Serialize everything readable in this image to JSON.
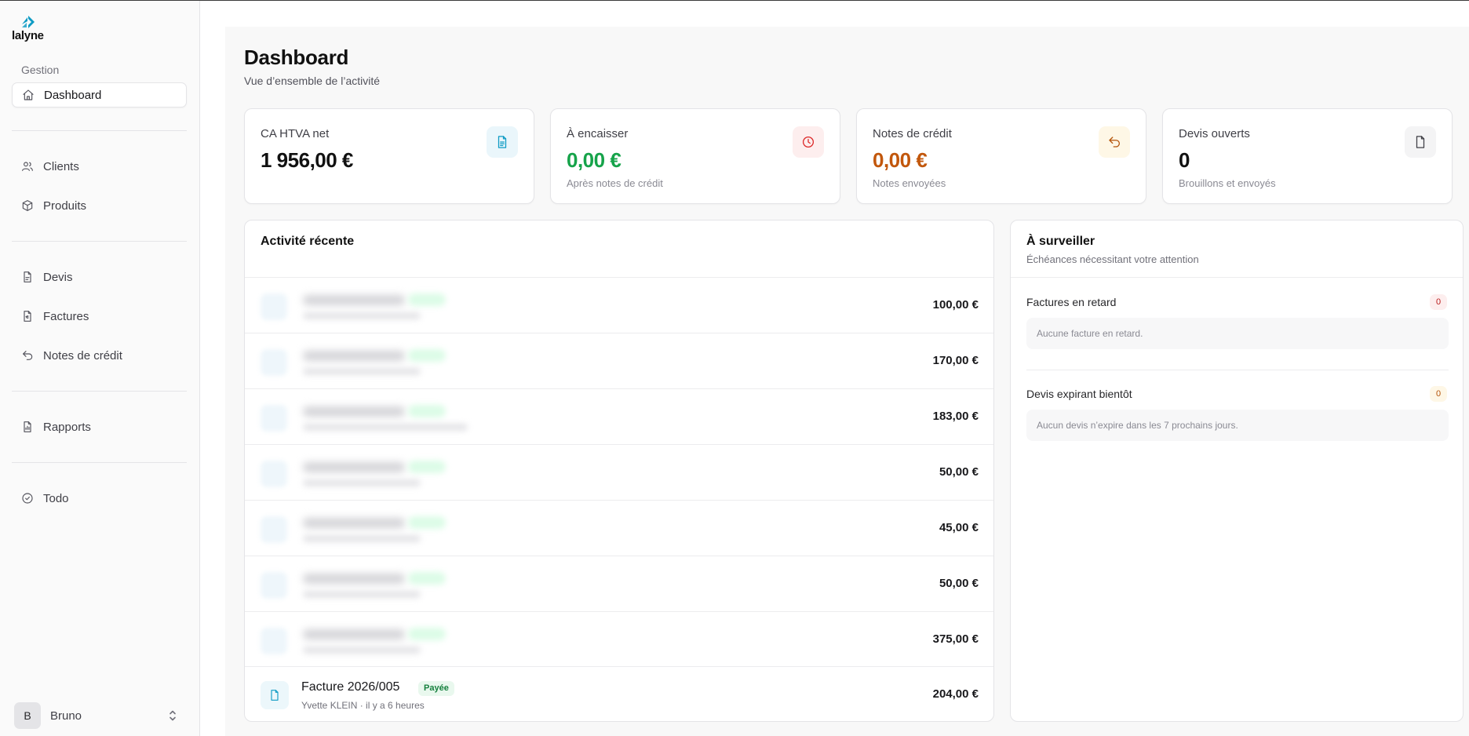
{
  "brand": {
    "name": "lalyne",
    "accent": "#0e9bc4"
  },
  "sidebar": {
    "section_label": "Gestion",
    "items": [
      {
        "label": "Dashboard",
        "icon": "home-icon",
        "active": true
      },
      {
        "label": "Clients",
        "icon": "users-icon"
      },
      {
        "label": "Produits",
        "icon": "box-icon"
      },
      {
        "label": "Devis",
        "icon": "file-icon"
      },
      {
        "label": "Factures",
        "icon": "invoice-icon"
      },
      {
        "label": "Notes de crédit",
        "icon": "undo-icon"
      },
      {
        "label": "Rapports",
        "icon": "report-icon"
      },
      {
        "label": "Todo",
        "icon": "check-circle-icon"
      }
    ],
    "user": {
      "initial": "B",
      "name": "Bruno"
    }
  },
  "header": {
    "title": "Dashboard",
    "subtitle": "Vue d’ensemble de l’activité"
  },
  "stats": [
    {
      "label": "CA HTVA net",
      "value": "1 956,00 €",
      "sub": "",
      "color": "#111111",
      "icon": "document-icon",
      "icon_bg": "#eaf6fb",
      "icon_color": "#0e9bc4"
    },
    {
      "label": "À encaisser",
      "value": "0,00 €",
      "sub": "Après notes de crédit",
      "color": "#16a34a",
      "icon": "clock-icon",
      "icon_bg": "#fdeeee",
      "icon_color": "#dc2626"
    },
    {
      "label": "Notes de crédit",
      "value": "0,00 €",
      "sub": "Notes envoyées",
      "color": "#c2570c",
      "icon": "undo-icon",
      "icon_bg": "#fef7e6",
      "icon_color": "#b45309"
    },
    {
      "label": "Devis ouverts",
      "value": "0",
      "sub": "Brouillons et envoyés",
      "color": "#111111",
      "icon": "file-icon",
      "icon_bg": "#f4f4f5",
      "icon_color": "#3f3f46"
    }
  ],
  "activity": {
    "title": "Activité récente",
    "amounts": [
      "100,00 €",
      "170,00 €",
      "183,00 €",
      "50,00 €",
      "45,00 €",
      "50,00 €",
      "375,00 €"
    ],
    "last": {
      "title": "Facture 2026/005",
      "badge": "Payée",
      "sub": "Yvette KLEIN · il y a 6 heures",
      "amount": "204,00 €"
    }
  },
  "watch": {
    "title": "À surveiller",
    "subtitle": "Échéances nécessitant votre attention",
    "overdue": {
      "title": "Factures en retard",
      "count": "0",
      "empty": "Aucune facture en retard."
    },
    "expiring": {
      "title": "Devis expirant bientôt",
      "count": "0",
      "empty": "Aucun devis n’expire dans les 7 prochains jours."
    }
  }
}
